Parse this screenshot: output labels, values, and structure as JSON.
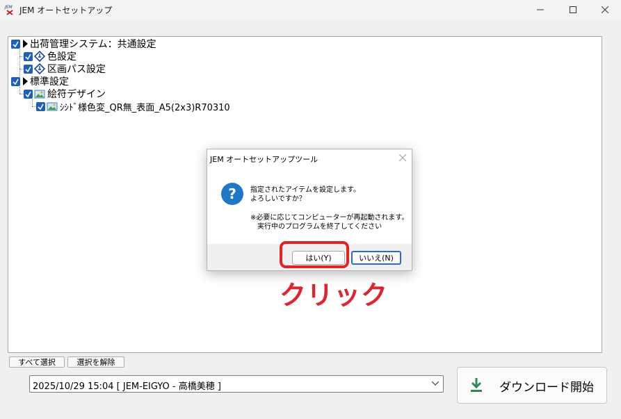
{
  "window": {
    "title": "JEM オートセットアップ",
    "icon": "jem-logo-icon"
  },
  "tree": {
    "nodes": [
      {
        "label": "出荷管理システム：共通設定",
        "checked": true
      },
      {
        "label": "色設定",
        "checked": true
      },
      {
        "label": "区画パス設定",
        "checked": true
      },
      {
        "label": "標準設定",
        "checked": true
      },
      {
        "label": "絵符デザイン",
        "checked": true
      },
      {
        "label": "ｼｼﾄﾞ様色変_QR無_表面_A5(2x3)R70310",
        "checked": true
      }
    ]
  },
  "buttons": {
    "select_all": "すべて選択",
    "deselect": "選択を解除",
    "download": "ダウンロード開始"
  },
  "combo": {
    "value": "2025/10/29 15:04 [ JEM-EIGYO - 高橋美穂 ]"
  },
  "dialog": {
    "title": "JEM オートセットアップツール",
    "line1": "指定されたアイテムを設定します。",
    "line2": "よろしいですか？",
    "line3": "※必要に応じてコンピューターが再起動されます。",
    "line4": "実行中のプログラムを終了してください",
    "yes": "はい(Y)",
    "no": "いいえ(N)"
  },
  "annotation": {
    "text": "クリック",
    "color": "#e0242d"
  },
  "colors": {
    "checkbox": "#1f5fb8",
    "question_icon": "#1e78c8",
    "default_button_border": "#2a6ad4",
    "download_icon": "#2e8b57"
  }
}
